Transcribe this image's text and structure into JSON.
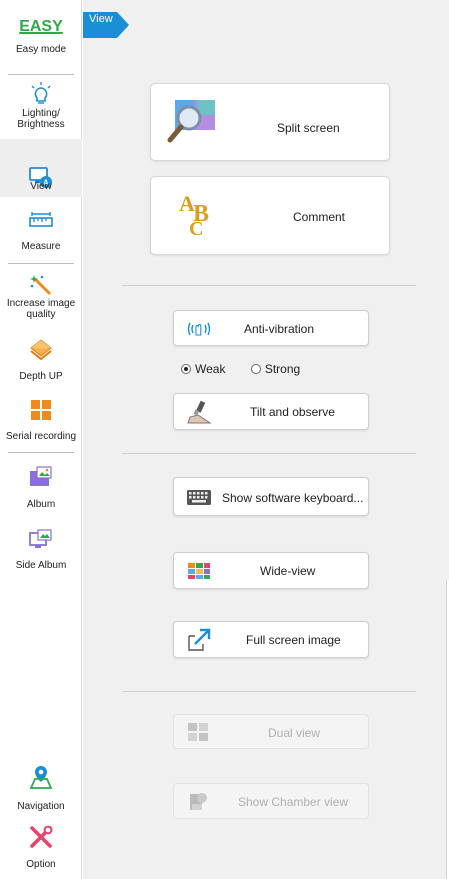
{
  "sidebar": {
    "items": [
      {
        "label": "Easy mode",
        "logo": "EASY",
        "icon": "easy-logo"
      },
      {
        "label": "Lighting/ Brightness",
        "icon": "lightbulb-icon"
      },
      {
        "label": "View",
        "icon": "view-screen-icon"
      },
      {
        "label": "Measure",
        "icon": "ruler-icon"
      },
      {
        "label": "Increase image quality",
        "icon": "magic-wand-icon"
      },
      {
        "label": "Depth UP",
        "icon": "layers-icon"
      },
      {
        "label": "Serial recording",
        "icon": "grid-icon"
      },
      {
        "label": "Album",
        "icon": "folder-image-icon"
      },
      {
        "label": "Side Album",
        "icon": "monitor-image-icon"
      },
      {
        "label": "Navigation",
        "icon": "map-pin-icon"
      },
      {
        "label": "Option",
        "icon": "tools-icon"
      }
    ]
  },
  "header": {
    "tag": "View"
  },
  "main": {
    "split_screen": "Split screen",
    "comment": "Comment",
    "anti_vibration": "Anti-vibration",
    "radio_weak": "Weak",
    "radio_strong": "Strong",
    "tilt": "Tilt and observe",
    "keyboard": "Show software keyboard...",
    "wide_view": "Wide-view",
    "full_screen": "Full screen image",
    "dual_view": "Dual view",
    "chamber_view": "Show Chamber view"
  },
  "colors": {
    "accent": "#1a8fd6",
    "easy_green": "#2eaa4a",
    "orange": "#f08a1c"
  }
}
